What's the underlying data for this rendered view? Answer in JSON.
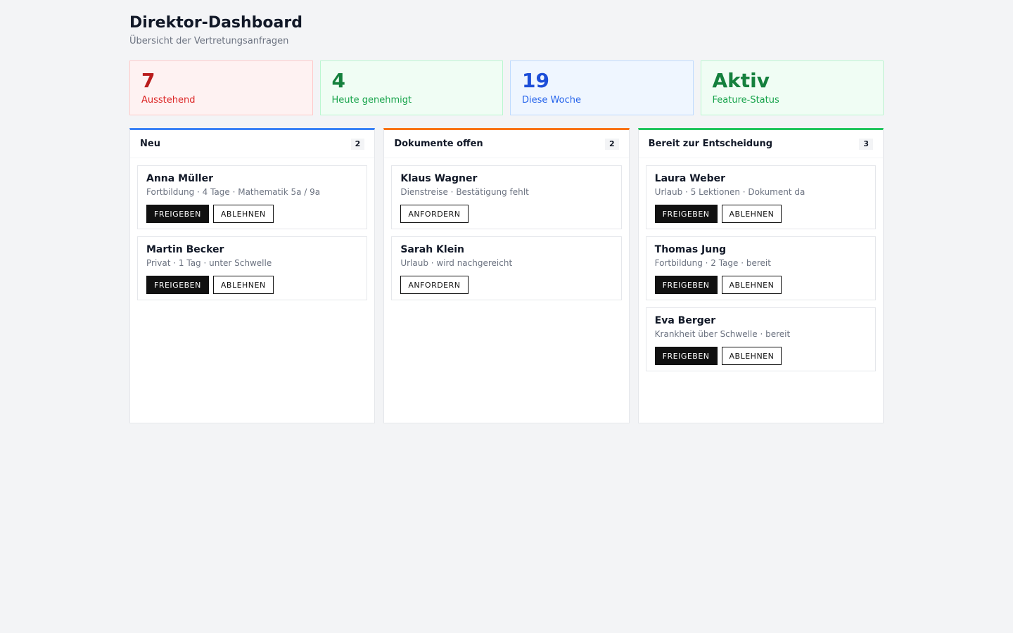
{
  "header": {
    "title": "Direktor-Dashboard",
    "subtitle": "Übersicht der Vertretungsanfragen"
  },
  "stats": [
    {
      "value": "7",
      "label": "Ausstehend"
    },
    {
      "value": "4",
      "label": "Heute genehmigt"
    },
    {
      "value": "19",
      "label": "Diese Woche"
    },
    {
      "value": "Aktiv",
      "label": "Feature-Status"
    }
  ],
  "columns": [
    {
      "title": "Neu",
      "count": "2",
      "cards": [
        {
          "name": "Anna Müller",
          "meta": "Fortbildung · 4 Tage · Mathematik 5a / 9a",
          "approve": "FREIGEBEN",
          "reject": "ABLEHNEN"
        },
        {
          "name": "Martin Becker",
          "meta": "Privat · 1 Tag · unter Schwelle",
          "approve": "FREIGEBEN",
          "reject": "ABLEHNEN"
        }
      ]
    },
    {
      "title": "Dokumente offen",
      "count": "2",
      "cards": [
        {
          "name": "Klaus Wagner",
          "meta": "Dienstreise · Bestätigung fehlt",
          "request": "ANFORDERN"
        },
        {
          "name": "Sarah Klein",
          "meta": "Urlaub · wird nachgereicht",
          "request": "ANFORDERN"
        }
      ]
    },
    {
      "title": "Bereit zur Entscheidung",
      "count": "3",
      "cards": [
        {
          "name": "Laura Weber",
          "meta": "Urlaub · 5 Lektionen · Dokument da",
          "approve": "FREIGEBEN",
          "reject": "ABLEHNEN"
        },
        {
          "name": "Thomas Jung",
          "meta": "Fortbildung · 2 Tage · bereit",
          "approve": "FREIGEBEN",
          "reject": "ABLEHNEN"
        },
        {
          "name": "Eva Berger",
          "meta": "Krankheit über Schwelle · bereit",
          "approve": "FREIGEBEN",
          "reject": "ABLEHNEN"
        }
      ]
    }
  ],
  "colors": {
    "accent_new": "#3b82f6",
    "accent_docs": "#f97316",
    "accent_ready": "#22c55e",
    "pending": "#b91c1c",
    "approved": "#15803d",
    "week": "#1d4ed8"
  }
}
